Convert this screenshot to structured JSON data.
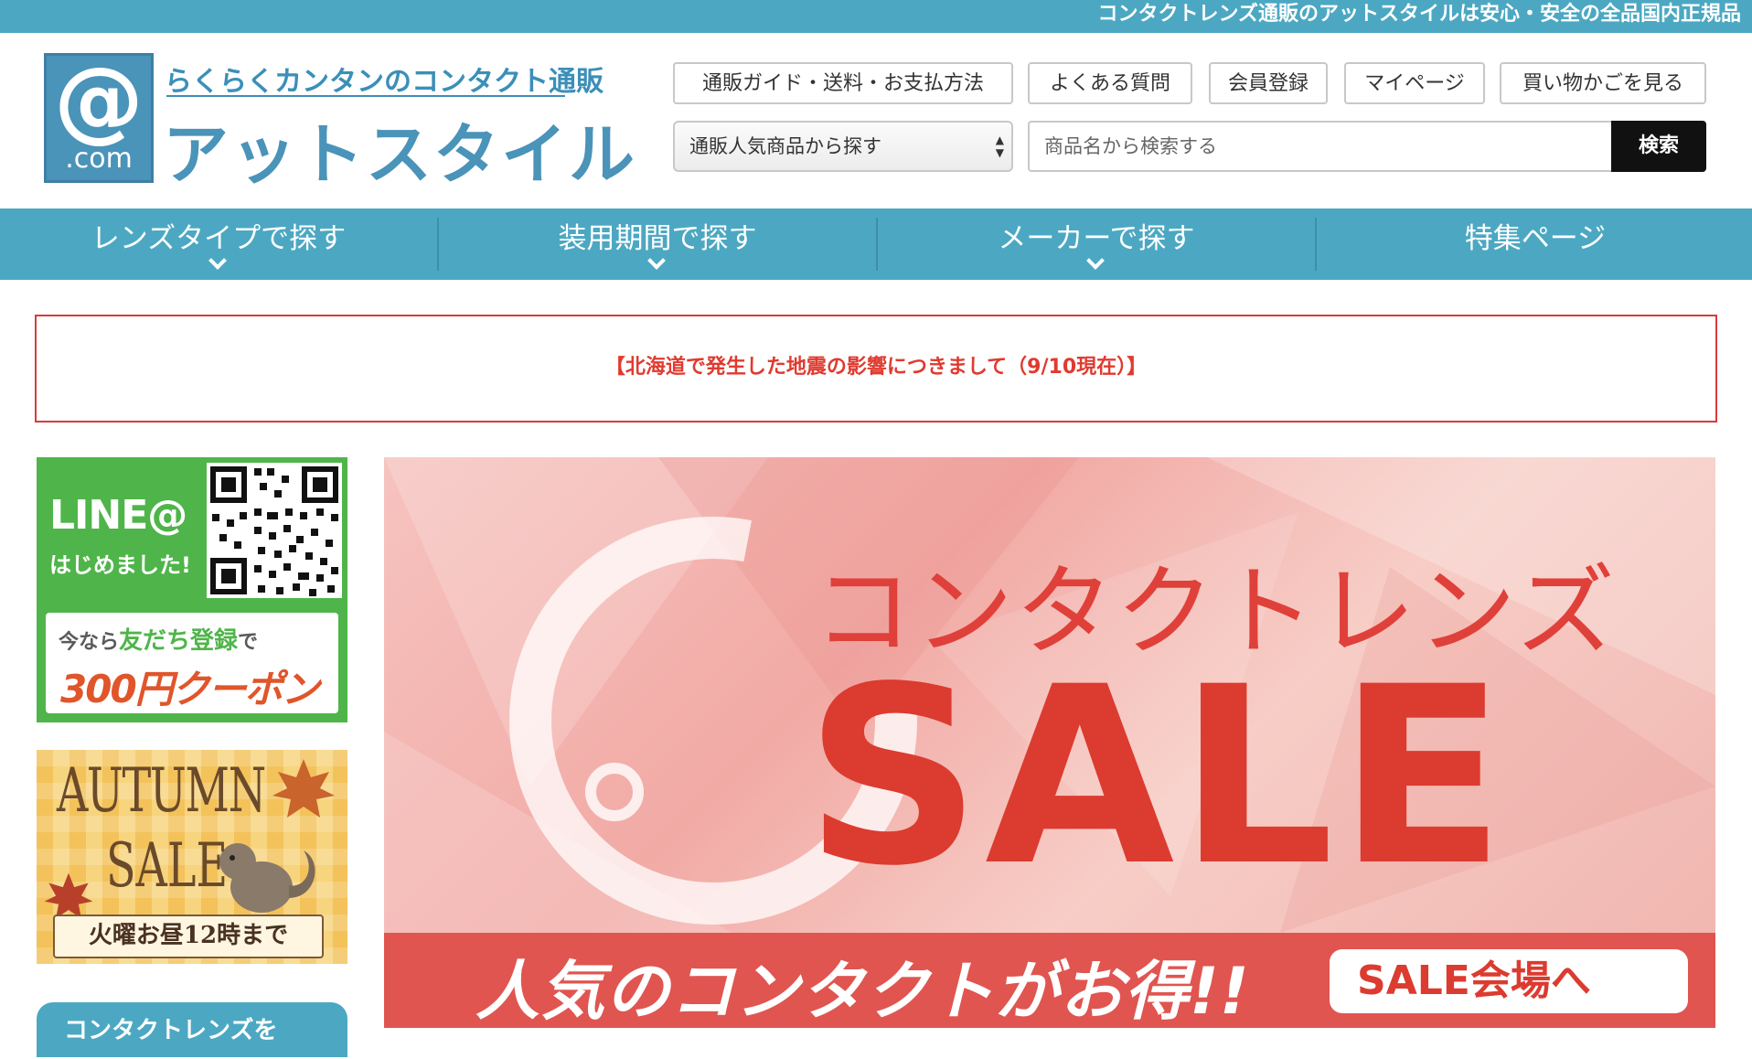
{
  "topbar": {
    "text": "コンタクトレンズ通販のアットスタイルは安心・安全の全品国内正規品"
  },
  "logo": {
    "mark_at": "@",
    "mark_com": ".com",
    "tagline": "らくらくカンタンのコンタクト通販",
    "name": "アットスタイル"
  },
  "header_links": [
    "通販ガイド・送料・お支払方法",
    "よくある質問",
    "会員登録",
    "マイページ",
    "買い物かごを見る"
  ],
  "category_select": {
    "selected": "通販人気商品から探す"
  },
  "search": {
    "placeholder": "商品名から検索する",
    "button": "検索"
  },
  "nav": [
    "レンズタイプで探す",
    "装用期間で探す",
    "メーカーで探す",
    "特集ページ"
  ],
  "notice": "【北海道で発生した地震の影響につきまして（9/10現在）】",
  "line_banner": {
    "title": "LINE@",
    "subtitle": "はじめました!",
    "reg_pre": "今なら",
    "reg_main": "友だち登録",
    "reg_post": "で",
    "coupon": "300円クーポン"
  },
  "autumn_banner": {
    "line1": "AUTUMN",
    "line2": "SALE",
    "tag": "火曜お昼12時まで"
  },
  "side_tab": "コンタクトレンズを",
  "sale_banner": {
    "title": "コンタクトレンズ",
    "big": "SALE",
    "tagline": "人気のコンタクトがお得!!",
    "cta": "SALE会場へ"
  },
  "colors": {
    "brand_teal": "#4ca8c2",
    "notice_red": "#e03a2f",
    "sale_red": "#dc3b30",
    "line_green": "#4fb54a"
  }
}
